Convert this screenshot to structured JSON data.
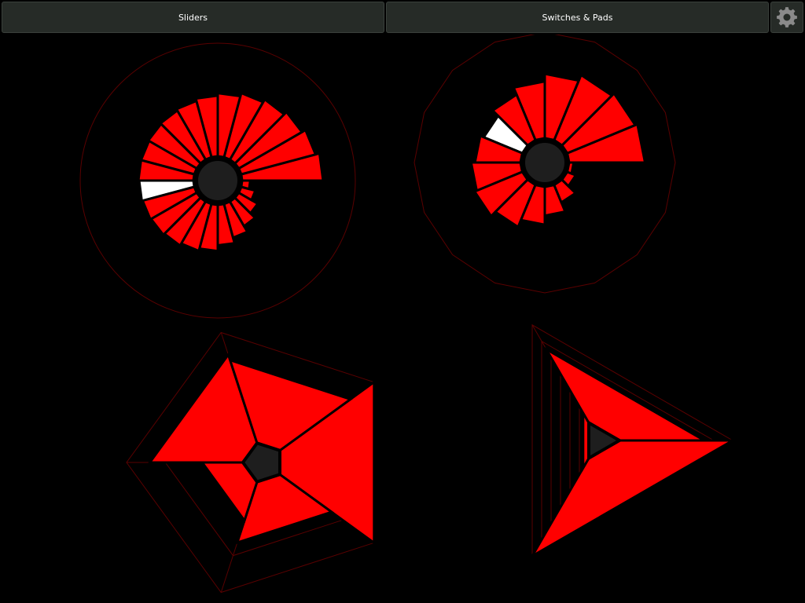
{
  "tabs": [
    {
      "label": "Sliders",
      "active": true
    },
    {
      "label": "Switches & Pads",
      "active": false
    }
  ],
  "settings": {
    "icon": "gear-icon",
    "color": "#8a8a8a"
  },
  "colors": {
    "background": "#000000",
    "segment_on": "#ff0000",
    "segment_selected": "#ffffff",
    "hub": "#1e1e1e",
    "outline": "#5a0000",
    "tab_bg": "#262b27"
  },
  "widgets": [
    {
      "name": "multislider-radial-24",
      "kind": "radial",
      "count": 24,
      "values": [
        1.0,
        0.95,
        0.9,
        0.86,
        0.82,
        0.78,
        0.75,
        0.72,
        0.7,
        0.69,
        0.68,
        0.68,
        0.67,
        0.66,
        0.65,
        0.63,
        0.6,
        0.57,
        0.5,
        0.43,
        0.35,
        0.27,
        0.18,
        0.1
      ],
      "selected_index": 12
    },
    {
      "name": "multislider-radial-16",
      "kind": "radial",
      "count": 16,
      "values": [
        1.0,
        0.97,
        0.93,
        0.85,
        0.75,
        0.65,
        0.55,
        0.6,
        0.65,
        0.68,
        0.6,
        0.5,
        0.38,
        0.25,
        0.12,
        0.06
      ],
      "selected_index": 6
    },
    {
      "name": "multislider-pentagon",
      "kind": "polygon",
      "count": 5,
      "values": [
        1.0,
        0.55,
        0.35,
        0.8,
        0.75
      ],
      "selected_index": -1
    },
    {
      "name": "multislider-triangle",
      "kind": "polygon",
      "count": 3,
      "values": [
        1.0,
        0.1,
        0.75
      ],
      "selected_index": -1
    }
  ]
}
